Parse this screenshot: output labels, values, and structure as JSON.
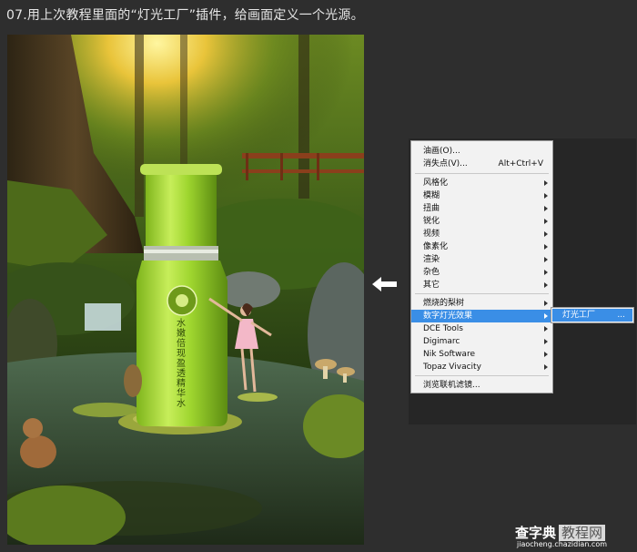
{
  "heading": "07.用上次教程里面的“灯光工厂”插件，给画面定义一个光源。",
  "product_label": "水嫩倍现盈透精华水",
  "menu": {
    "top": [
      {
        "label": "油画(O)...",
        "shortcut": ""
      },
      {
        "label": "消失点(V)...",
        "shortcut": "Alt+Ctrl+V"
      }
    ],
    "filters": [
      "风格化",
      "模糊",
      "扭曲",
      "锐化",
      "视频",
      "像素化",
      "渲染",
      "杂色",
      "其它"
    ],
    "plugins": [
      {
        "label": "燃烧的梨树",
        "highlighted": false
      },
      {
        "label": "数字灯光效果",
        "highlighted": true
      },
      {
        "label": "DCE Tools",
        "highlighted": false
      },
      {
        "label": "Digimarc",
        "highlighted": false
      },
      {
        "label": "Nik Software",
        "highlighted": false
      },
      {
        "label": "Topaz Vivacity",
        "highlighted": false
      }
    ],
    "browse": "浏览联机滤镜..."
  },
  "submenu": {
    "label": "灯光工厂",
    "dots": "..."
  },
  "watermark": {
    "line1": "查字典",
    "line1_boxed": "教程网",
    "line2": "jiaocheng.chazidian.com"
  },
  "colors": {
    "highlight": "#3a8ee6",
    "menu_bg": "#f2f2f2",
    "page_bg": "#2e2e2e"
  }
}
